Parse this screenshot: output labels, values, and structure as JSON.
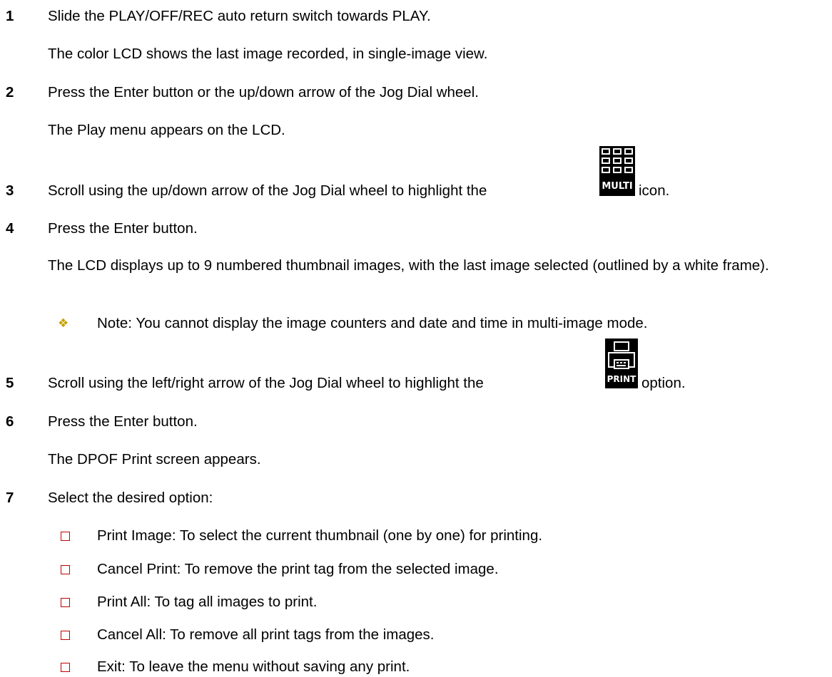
{
  "steps": [
    {
      "num": "1",
      "text": "Slide the PLAY/OFF/REC auto return switch towards PLAY."
    },
    {
      "num": "2",
      "text": "Press the Enter button or the up/down arrow of the Jog Dial wheel."
    },
    {
      "num": "3",
      "text_before": "Scroll using the up/down arrow of the Jog Dial wheel to highlight the",
      "text_after": "icon."
    },
    {
      "num": "4",
      "text": "Press the Enter button."
    },
    {
      "num": "5",
      "text_before": "Scroll using the left/right arrow of the Jog Dial wheel to highlight the",
      "text_after": "option."
    },
    {
      "num": "6",
      "text": "Press the Enter button."
    },
    {
      "num": "7",
      "text": "Select the desired option:"
    }
  ],
  "results": {
    "step1": "The color LCD shows the last image recorded, in single-image view.",
    "step2": "The Play menu appears on the LCD.",
    "step4": "The LCD displays up to 9 numbered thumbnail images, with the last image selected (outlined by a white frame).",
    "step6": "The DPOF Print screen appears."
  },
  "note": "Note: You cannot display the image counters and date and time in multi-image mode.",
  "icons": {
    "multi_label": "MULTI",
    "print_label": "PRINT"
  },
  "options": [
    "Print Image: To select the current thumbnail (one by one) for printing.",
    "Cancel Print: To remove the print tag from the selected image.",
    "Print All: To tag all images to print.",
    "Cancel All: To remove all print tags from the images.",
    "Exit: To leave the menu without saving any print."
  ],
  "colors": {
    "diamond": "#c8a000",
    "checkbox": "#c00000"
  }
}
